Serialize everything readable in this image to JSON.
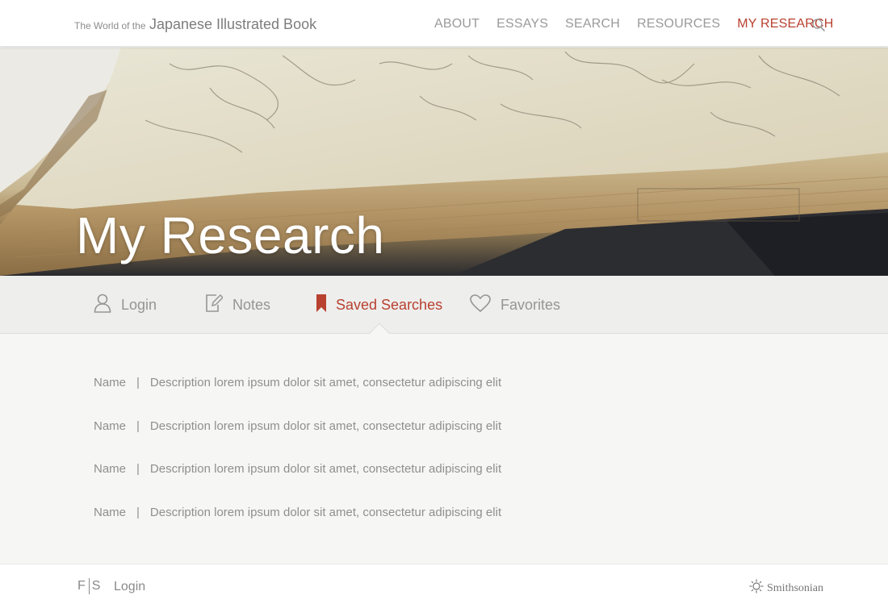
{
  "header": {
    "site_title_prefix": "The World of the",
    "site_title_main": "Japanese Illustrated Book",
    "nav": [
      {
        "label": "ABOUT"
      },
      {
        "label": "ESSAYS"
      },
      {
        "label": "SEARCH"
      },
      {
        "label": "RESOURCES"
      },
      {
        "label": "MY RESEARCH",
        "active": true
      }
    ],
    "search_icon": "search-icon"
  },
  "hero": {
    "title": "My Research"
  },
  "tabs": [
    {
      "label": "Login",
      "icon": "user-icon"
    },
    {
      "label": "Notes",
      "icon": "note-edit-icon"
    },
    {
      "label": "Saved Searches",
      "icon": "bookmark-icon",
      "active": true
    },
    {
      "label": "Favorites",
      "icon": "heart-icon"
    }
  ],
  "saved_searches": [
    {
      "name": "Name",
      "separator": "|",
      "description": "Description lorem ipsum dolor sit amet, consectetur adipiscing elit"
    },
    {
      "name": "Name",
      "separator": "|",
      "description": "Description lorem ipsum dolor sit amet, consectetur adipiscing elit"
    },
    {
      "name": "Name",
      "separator": "|",
      "description": "Description lorem ipsum dolor sit amet, consectetur adipiscing elit"
    },
    {
      "name": "Name",
      "separator": "|",
      "description": "Description lorem ipsum dolor sit amet, consectetur adipiscing elit"
    }
  ],
  "footer": {
    "logo_left": "F",
    "logo_right": "S",
    "login_label": "Login",
    "smithsonian_label": "Smithsonian"
  },
  "colors": {
    "accent": "#b8412f",
    "text": "#8a8a8a",
    "background": "#f6f6f5"
  }
}
